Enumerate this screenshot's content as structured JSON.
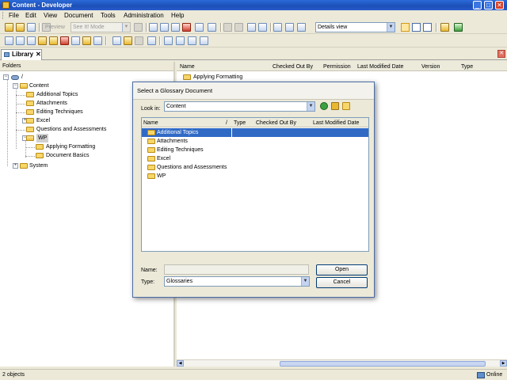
{
  "window": {
    "title": "Content - Developer"
  },
  "menu": [
    "File",
    "Edit",
    "View",
    "Document",
    "Tools",
    "Administration",
    "Help"
  ],
  "toolbar": {
    "preview_label": "Preview",
    "mode_select": "See It! Mode",
    "view_select": "Details view"
  },
  "tab": {
    "label": "Library",
    "close": "✕"
  },
  "folders_pane": {
    "header": "Folders",
    "tree": {
      "root": "/",
      "content": "Content",
      "items": [
        "Additional Topics",
        "Attachments",
        "Editing Techniques",
        "Excel",
        "Questions and Assessments",
        "WP"
      ],
      "wp_children": [
        "Applying Formatting",
        "Document Basics"
      ],
      "system": "System"
    }
  },
  "content_pane": {
    "columns": [
      "Name",
      "Checked Out By",
      "Permission",
      "Last Modified Date",
      "Version",
      "Type"
    ],
    "rows": [
      "Applying Formatting"
    ]
  },
  "dialog": {
    "title": "Select a Glossary Document",
    "look_in_label": "Look in:",
    "look_in_value": "Content",
    "columns": [
      "Name",
      "/",
      "Type",
      "Checked Out By",
      "Last Modified Date"
    ],
    "items": [
      "Additional Topics",
      "Attachments",
      "Editing Techniques",
      "Excel",
      "Questions and Assessments",
      "WP"
    ],
    "selected_index": 0,
    "name_label": "Name:",
    "name_value": "",
    "type_label": "Type:",
    "type_value": "Glossaries",
    "open_button": "Open",
    "cancel_button": "Cancel"
  },
  "status": {
    "left": "2 objects",
    "right": "Online"
  }
}
